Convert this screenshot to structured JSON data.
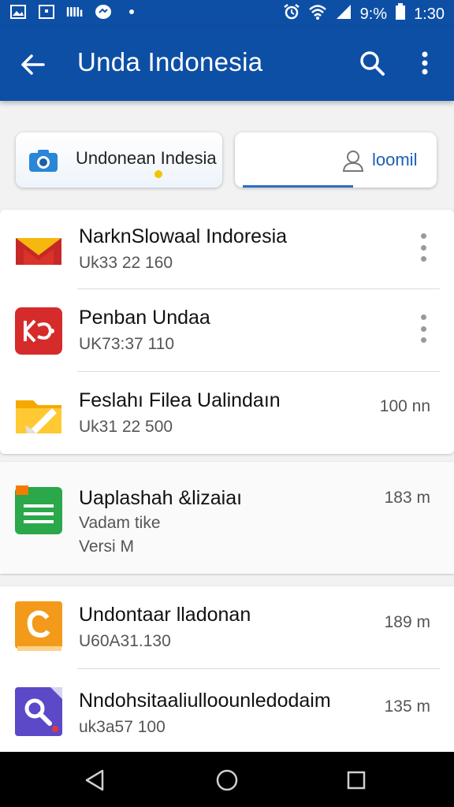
{
  "status_bar": {
    "battery_text": "9:%",
    "time": "1:30"
  },
  "app_bar": {
    "title": "Unda Indonesia"
  },
  "chips": [
    {
      "label": "Undonean Indesia"
    },
    {
      "label": "loomil"
    }
  ],
  "items": [
    {
      "title": "NarknSlowaal Indoresia",
      "subtitle": "Uk33 22 160",
      "meta": ""
    },
    {
      "title": "Penban Undaa",
      "subtitle": "UK73:37 110",
      "meta": ""
    },
    {
      "title": "Feslahı Filea Ualindaın",
      "subtitle": "Uk31 22 500",
      "meta": "100 nn"
    },
    {
      "title": "Uaplashah &lizaiaı",
      "subtitle": "Vadam tike",
      "subtitle2": "Versi M",
      "meta": "183 m"
    },
    {
      "title": "Undontaar lladonan",
      "subtitle": "U60A31.130",
      "meta": "189 m"
    },
    {
      "title": "Nndohsitaaliulloounledodaim",
      "subtitle": "uk3a57 100",
      "meta": "135 m"
    }
  ],
  "colors": {
    "app_bar": "#0d4fa5",
    "accent": "#1c5fb8"
  }
}
